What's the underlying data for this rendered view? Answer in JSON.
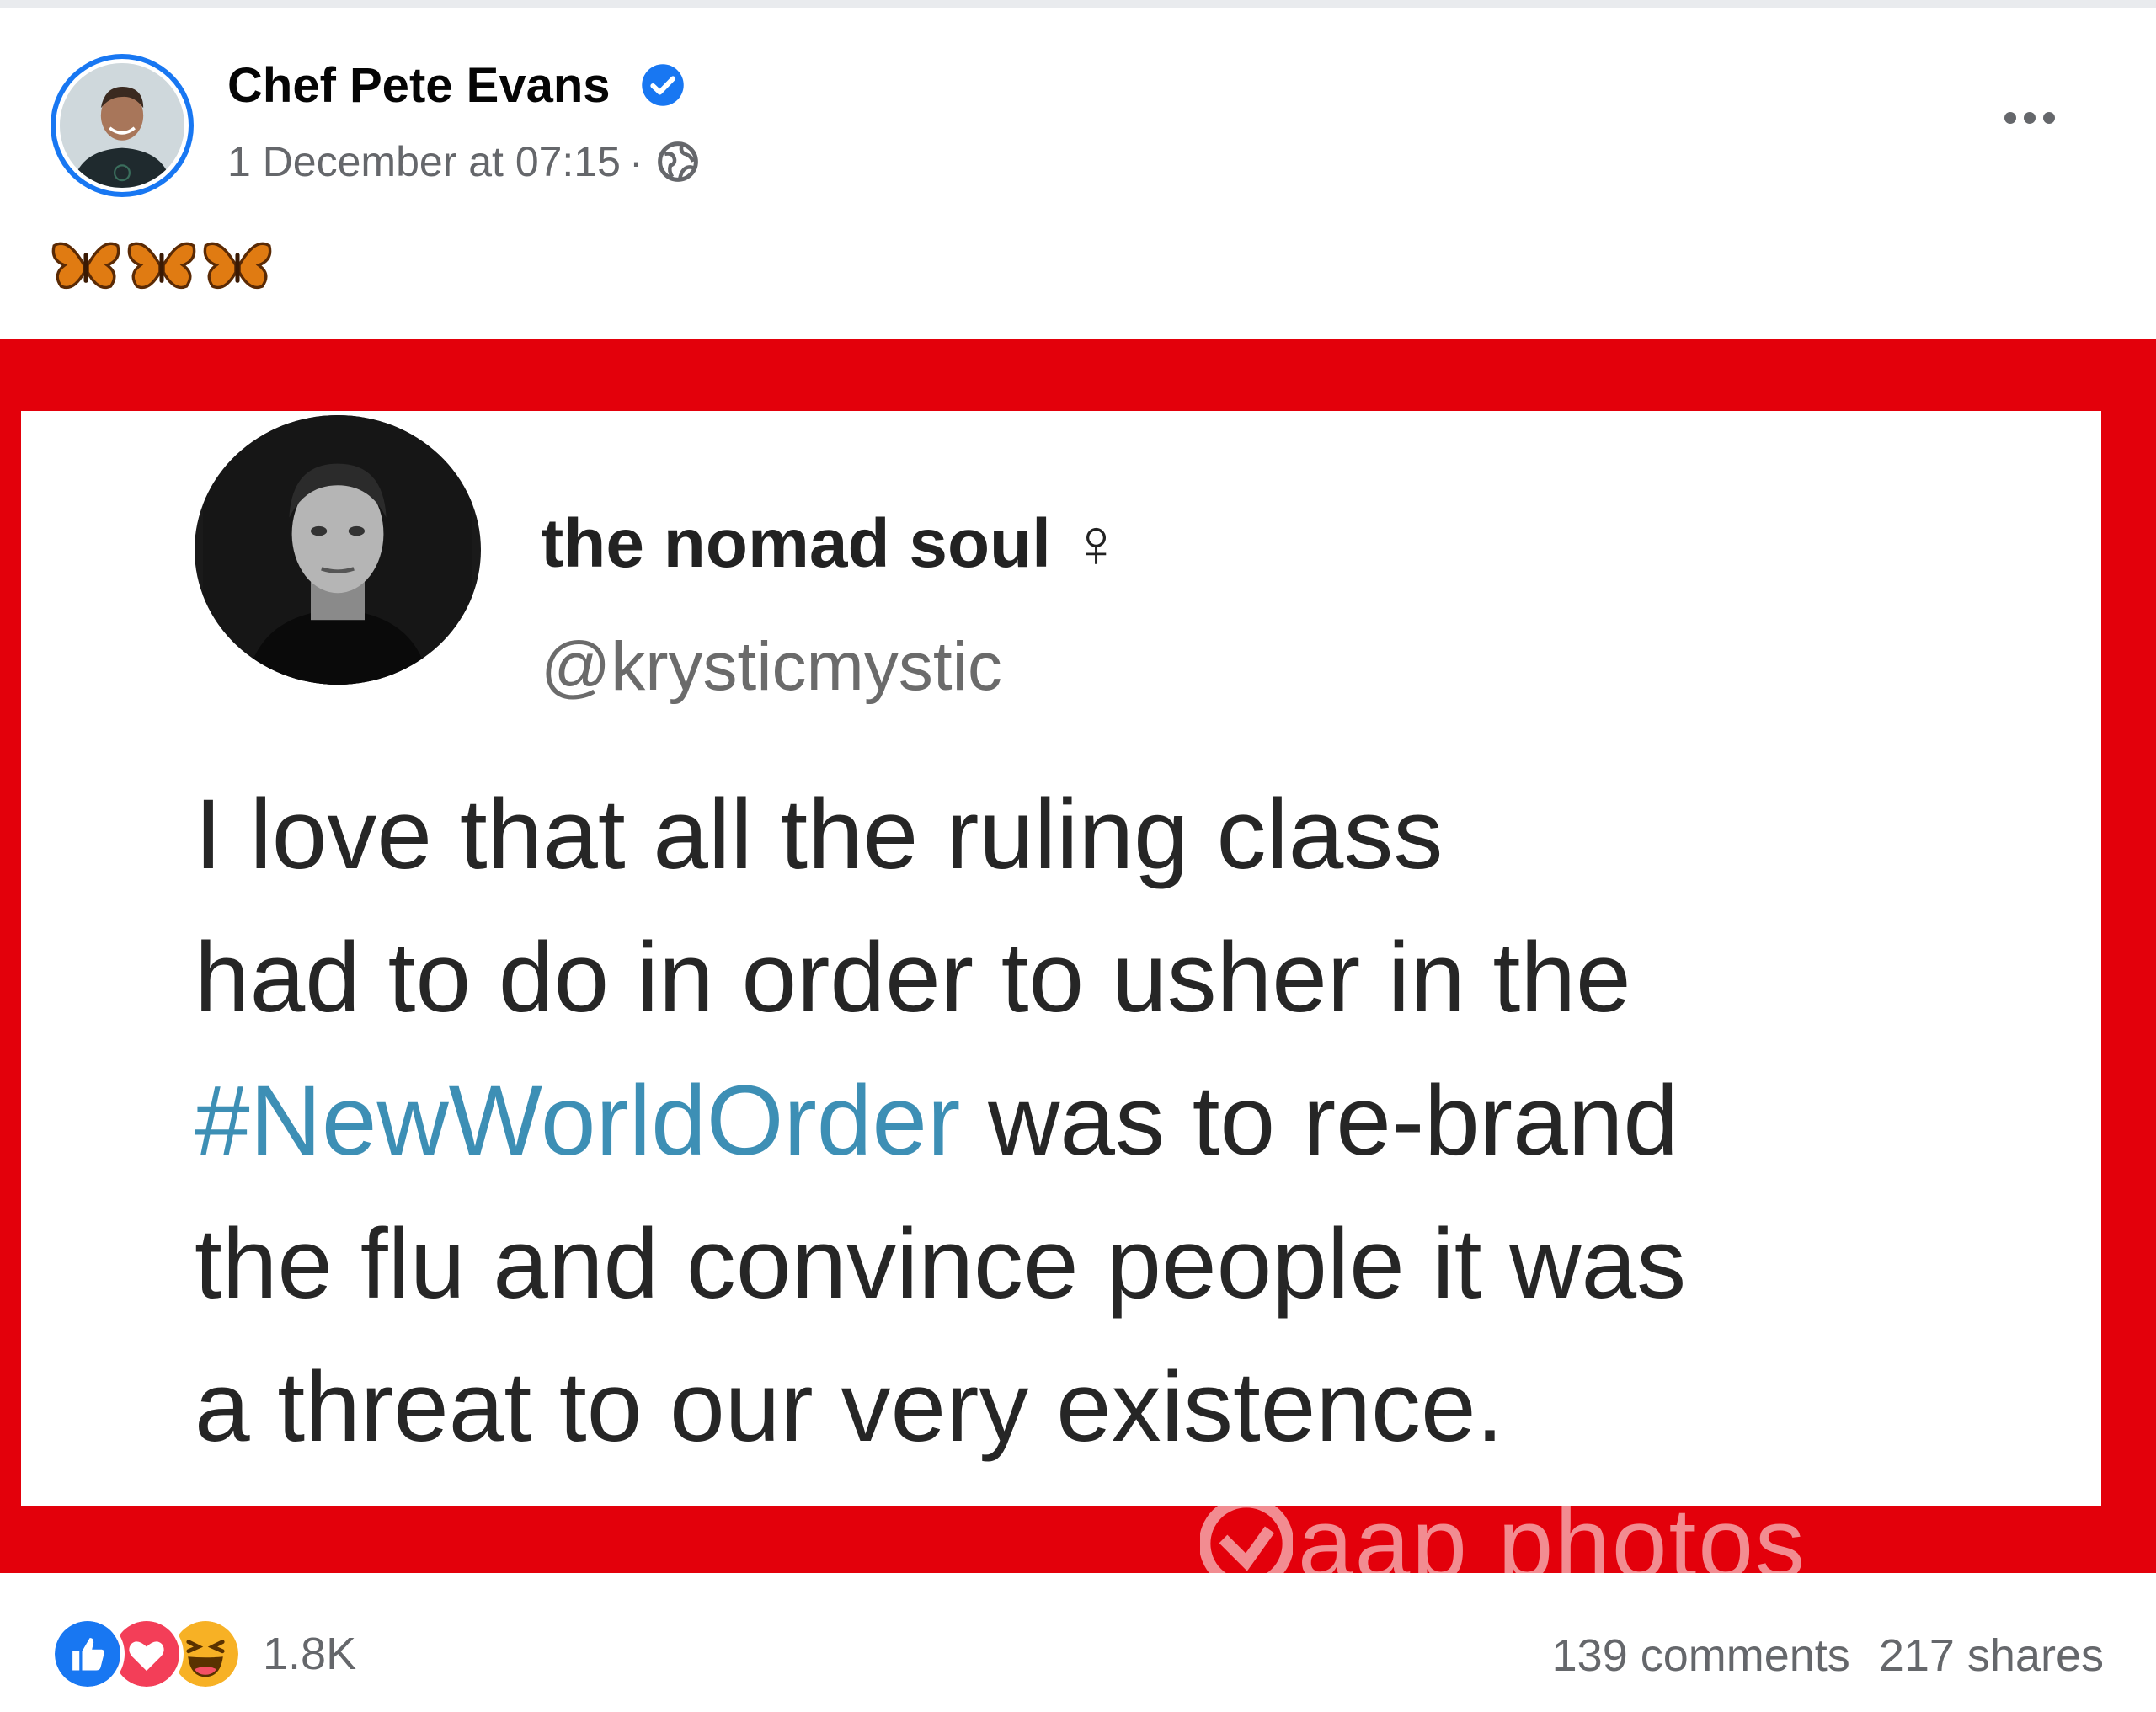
{
  "post": {
    "author": "Chef Pete Evans",
    "timestamp": "1 December at 07:15",
    "separator": "·",
    "verified_icon": "verified-badge-icon",
    "audience_icon": "globe-icon",
    "more_icon": "more-options-icon",
    "text_emojis": [
      "butterfly-icon",
      "butterfly-icon",
      "butterfly-icon"
    ]
  },
  "shared_image": {
    "frame_color": "#e3000b",
    "tweet": {
      "name": "the nomad soul ♀",
      "handle": "@krysticmystic",
      "body_lines": [
        "I love that all the ruling class",
        "had to do in order to usher in the",
        "",
        "the flu and convince people it was",
        "a threat to our very existence."
      ],
      "hashtag": "#NewWorldOrder",
      "line3_rest": " was to re-brand",
      "hashtag_color": "#3d8fb5"
    },
    "watermark": "aap photos"
  },
  "footer": {
    "reaction_icons": [
      "like-reaction-icon",
      "love-reaction-icon",
      "haha-reaction-icon"
    ],
    "reaction_count": "1.8K",
    "comments": "139 comments",
    "shares": "217 shares"
  },
  "colors": {
    "facebook_blue": "#1877f2",
    "love_red": "#f33e58",
    "haha_yellow": "#f7b125",
    "secondary_text": "#65676b"
  }
}
